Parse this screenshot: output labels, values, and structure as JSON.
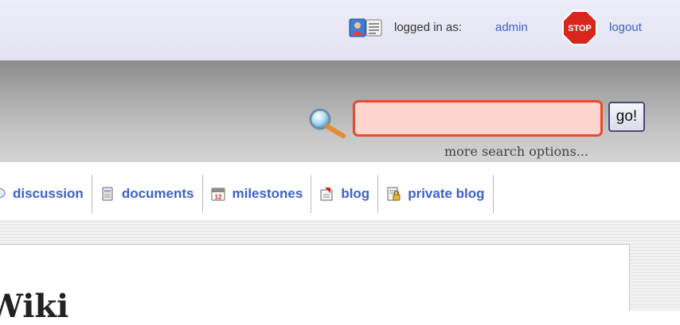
{
  "topbar": {
    "logged_in_label": "logged in as:",
    "username": "admin",
    "logout_label": "logout",
    "user_icon": "user-card-icon",
    "stop_icon": "stop-sign-icon",
    "stop_icon_text": "STOP"
  },
  "search": {
    "value": "",
    "placeholder": "",
    "go_label": "go!",
    "more_options": "more search options...",
    "icon": "magnifier-icon"
  },
  "tabs": [
    {
      "label": "discussion",
      "icon": "discussion-icon"
    },
    {
      "label": "documents",
      "icon": "documents-icon"
    },
    {
      "label": "milestones",
      "icon": "calendar-icon",
      "icon_text": "12"
    },
    {
      "label": "blog",
      "icon": "blog-icon"
    },
    {
      "label": "private blog",
      "icon": "private-blog-icon"
    }
  ],
  "page": {
    "title": "Wiki"
  },
  "colors": {
    "link": "#3a62c9",
    "search_border": "#e64a2c",
    "search_fill": "#ffd5cf"
  }
}
